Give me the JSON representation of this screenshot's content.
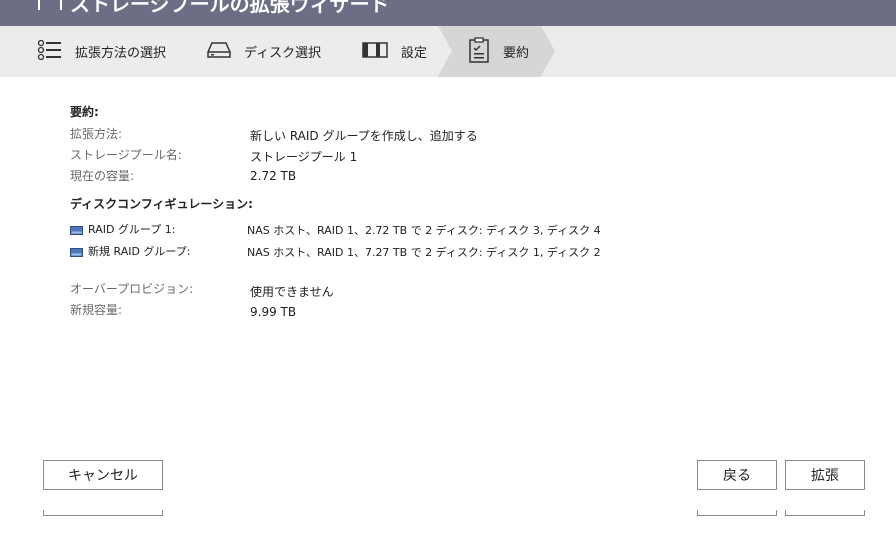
{
  "window": {
    "title": "ストレージプールの拡張ウィザード"
  },
  "steps": [
    {
      "label": "拡張方法の選択",
      "icon": "list-icon"
    },
    {
      "label": "ディスク選択",
      "icon": "disk-drive-icon"
    },
    {
      "label": "設定",
      "icon": "settings-panel-icon"
    },
    {
      "label": "要約",
      "icon": "clipboard-check-icon",
      "active": true
    }
  ],
  "summary": {
    "heading": "要約:",
    "expand_method_label": "拡張方法:",
    "expand_method_value": "新しい RAID グループを作成し、追加する",
    "pool_name_label": "ストレージプール名:",
    "pool_name_value": "ストレージプール 1",
    "current_capacity_label": "現在の容量:",
    "current_capacity_value": "2.72 TB"
  },
  "disk_config": {
    "heading": "ディスクコンフィギュレーション:",
    "groups": [
      {
        "label": "RAID グループ 1:",
        "value": "NAS ホスト、RAID 1、2.72 TB で 2 ディスク: ディスク 3,  ディスク 4"
      },
      {
        "label": "新規 RAID グループ:",
        "value": "NAS ホスト、RAID 1、7.27 TB で 2 ディスク: ディスク 1,  ディスク 2"
      }
    ]
  },
  "provisioning": {
    "over_provision_label": "オーバープロビジョン:",
    "over_provision_value": "使用できません",
    "new_capacity_label": "新規容量:",
    "new_capacity_value": "9.99 TB"
  },
  "buttons": {
    "cancel": "キャンセル",
    "back": "戻る",
    "expand": "拡張"
  },
  "colors": {
    "titlebar": "#6b6e84",
    "steps_bg": "#ececec",
    "active_step": "#d6d6d6",
    "disk_icon": "#4a78b8"
  }
}
